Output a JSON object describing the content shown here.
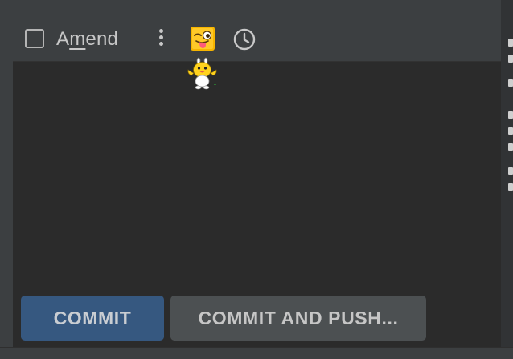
{
  "amend": {
    "label_before": "A",
    "label_mnemonic": "m",
    "label_after": "end",
    "checked": false
  },
  "toolbar": {
    "options_icon": "kebab-vertical-icon",
    "emoji_icon": "winking-face-tongue-icon",
    "history_icon": "clock-icon"
  },
  "buttons": {
    "commit_label": "COMMIT",
    "commit_push_label": "COMMIT AND PUSH..."
  },
  "colors": {
    "primary_button": "#365880",
    "secondary_button": "#4c5052",
    "editor_background": "#2b2b2b"
  }
}
